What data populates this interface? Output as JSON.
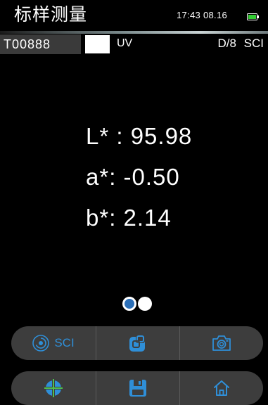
{
  "header": {
    "title": "标样测量",
    "time": "17:43",
    "date": "08.16",
    "battery_icon": "battery-icon",
    "battery_color": "#33cc33"
  },
  "info_bar": {
    "sample_id": "T00888",
    "swatch_color": "#ffffff",
    "uv": "UV",
    "geometry": "D/8",
    "mode": "SCI"
  },
  "measurement": {
    "L_line": "L* : 95.98",
    "a_line": "a*: -0.50",
    "b_line": "b*: 2.14"
  },
  "pager": {
    "active_page": 1,
    "total_pages": 2
  },
  "toolbar_top": {
    "sci_label": "SCI",
    "sci_icon": "target-icon",
    "swap_icon": "overlapping-squares-icon",
    "camera_icon": "camera-icon"
  },
  "toolbar_bottom": {
    "crosshair_icon": "crosshair-icon",
    "save_icon": "floppy-disk-icon",
    "home_icon": "home-icon"
  },
  "colors": {
    "accent": "#2f8fd8",
    "toolbar_bg": "#3d3d3d",
    "sample_bg": "#3a3a3a"
  }
}
